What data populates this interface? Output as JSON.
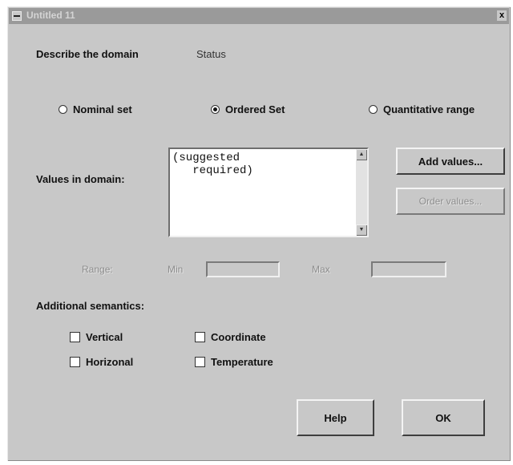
{
  "window": {
    "title": "Untitled 11",
    "close_label": "x"
  },
  "domain": {
    "describe_label": "Describe the domain",
    "value": "Status"
  },
  "domain_type": {
    "options": [
      "Nominal set",
      "Ordered Set",
      "Quantitative range"
    ],
    "selected": "Ordered Set"
  },
  "values": {
    "label": "Values in domain:",
    "text": "(suggested\n   required)",
    "add_button": "Add values...",
    "order_button": "Order values..."
  },
  "range": {
    "label": "Range:",
    "min_label": "Min",
    "min_value": "",
    "max_label": "Max",
    "max_value": ""
  },
  "semantics": {
    "label": "Additional semantics:",
    "vertical": "Vertical",
    "horizontal": "Horizonal",
    "coordinate": "Coordinate",
    "temperature": "Temperature"
  },
  "buttons": {
    "help": "Help",
    "ok": "OK"
  }
}
